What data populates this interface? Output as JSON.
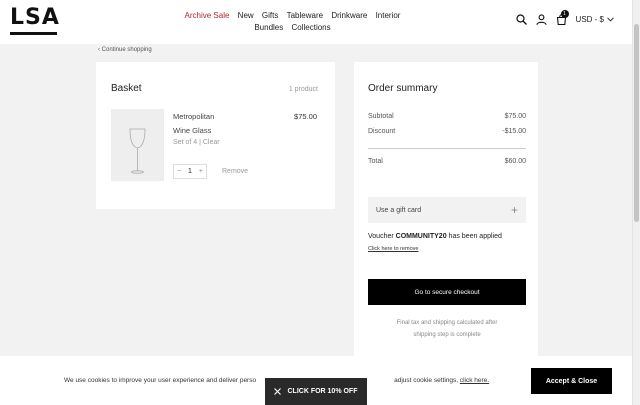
{
  "header": {
    "logo_text": "LSA",
    "nav": [
      "Archive Sale",
      "New",
      "Gifts",
      "Tableware",
      "Drinkware",
      "Interior",
      "Bundles",
      "Collections"
    ],
    "cart_count": "1",
    "currency": "USD - $",
    "sale_color": "#b3262b"
  },
  "continue_label": "Continue shopping",
  "basket": {
    "title": "Basket",
    "count": "1 product",
    "item": {
      "name_line1": "Metropolitan",
      "name_line2": "Wine Glass",
      "meta": "Set of 4 | Clear",
      "price": "$75.00",
      "quantity": "1",
      "remove_label": "Remove"
    }
  },
  "summary": {
    "title": "Order summary",
    "subtotal_label": "Subtotal",
    "subtotal_value": "$75.00",
    "discount_label": "Discount",
    "discount_value": "-$15.00",
    "total_label": "Total",
    "total_value": "$60.00",
    "gift_card_label": "Use a gift card",
    "voucher_prefix": "Voucher",
    "voucher_code": "COMMUNITY20",
    "voucher_suffix": "has been applied",
    "voucher_remove": "Click here to remove",
    "checkout_label": "Go to secure checkout",
    "note_line1": "Final tax and shipping calculated after",
    "note_line2": "shipping step is complete"
  },
  "cookie": {
    "text": "We use cookies to improve your user experience and deliver perso",
    "text_end": "adjust cookie settings,",
    "link": "click here.",
    "accept_label": "Accept & Close"
  },
  "promo": {
    "label": "CLICK FOR 10% OFF"
  }
}
